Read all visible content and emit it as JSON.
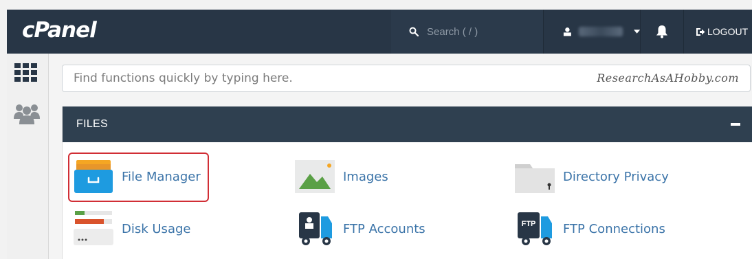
{
  "header": {
    "logo": "cPanel",
    "search_placeholder": "Search ( / )",
    "logout_label": "LOGOUT"
  },
  "quickfind": {
    "placeholder": "Find functions quickly by typing here.",
    "watermark": "ResearchAsAHobby.com"
  },
  "section": {
    "title": "FILES",
    "items": [
      {
        "label": "File Manager",
        "icon": "file-manager-icon",
        "highlighted": true
      },
      {
        "label": "Images",
        "icon": "images-icon"
      },
      {
        "label": "Directory Privacy",
        "icon": "directory-privacy-icon"
      },
      {
        "label": "Disk Usage",
        "icon": "disk-usage-icon"
      },
      {
        "label": "FTP Accounts",
        "icon": "ftp-accounts-icon"
      },
      {
        "label": "FTP Connections",
        "icon": "ftp-connections-icon"
      }
    ]
  },
  "colors": {
    "header_bg": "#283646",
    "panel_header_bg": "#2f4050",
    "link": "#3a73a8",
    "highlight": "#d12e35"
  }
}
